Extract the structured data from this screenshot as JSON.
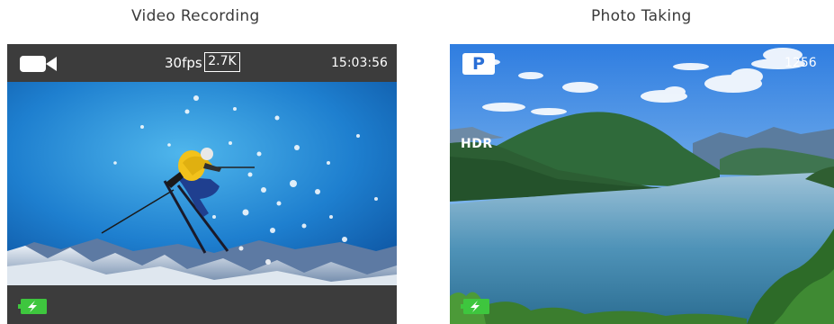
{
  "captions": {
    "video": "Video Recording",
    "photo": "Photo Taking"
  },
  "video_screen": {
    "mode_icon": "video-camera-icon",
    "fps": "30fps",
    "resolution": "2.7K",
    "time": "15:03:56",
    "battery_icon": "battery-charging-icon",
    "battery_color": "#3ec63e"
  },
  "photo_screen": {
    "mode_badge": "P",
    "mode_badge_color": "#2a6fd6",
    "shots_remaining": "1256",
    "hdr_label": "HDR",
    "battery_icon": "battery-charging-icon",
    "battery_color": "#3ec63e"
  }
}
